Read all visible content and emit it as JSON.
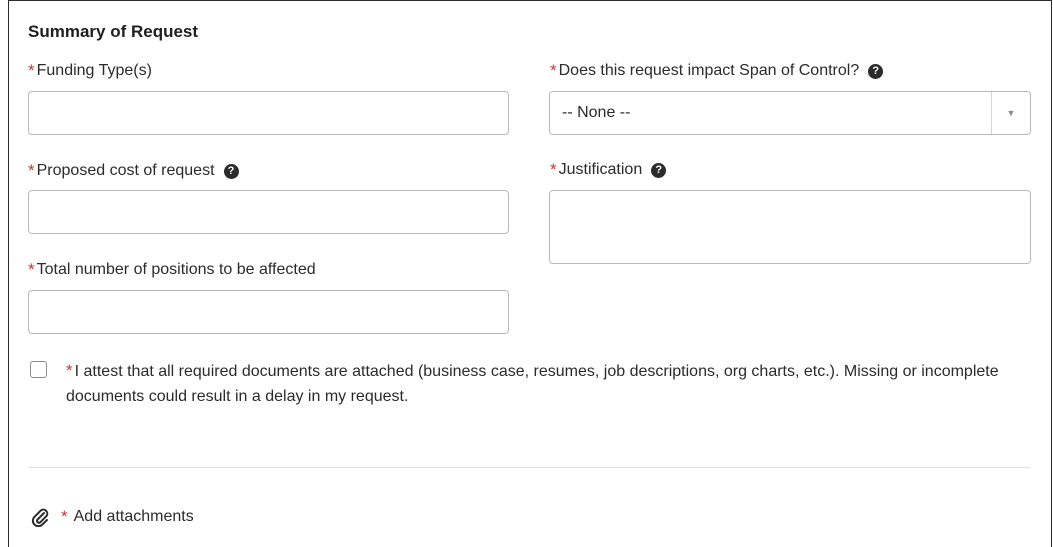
{
  "section": {
    "title": "Summary of Request"
  },
  "fields": {
    "funding_type": {
      "label": "Funding Type(s)",
      "value": ""
    },
    "span_of_control": {
      "label": "Does this request impact Span of Control?",
      "value": "-- None --"
    },
    "proposed_cost": {
      "label": "Proposed cost of request",
      "value": ""
    },
    "justification": {
      "label": "Justification",
      "value": ""
    },
    "positions_affected": {
      "label": "Total number of positions to be affected",
      "value": ""
    }
  },
  "attestation": {
    "checked": false,
    "text": "I attest that all required documents are attached (business case, resumes, job descriptions, org charts, etc.). Missing or incomplete documents could result in a delay in my request."
  },
  "attachments": {
    "label": "Add attachments",
    "icon": "paperclip-icon"
  },
  "required_marker": "*",
  "help_glyph": "?",
  "colors": {
    "required": "#c23934",
    "border": "#b9b9b9",
    "text": "#2b2b2b"
  }
}
